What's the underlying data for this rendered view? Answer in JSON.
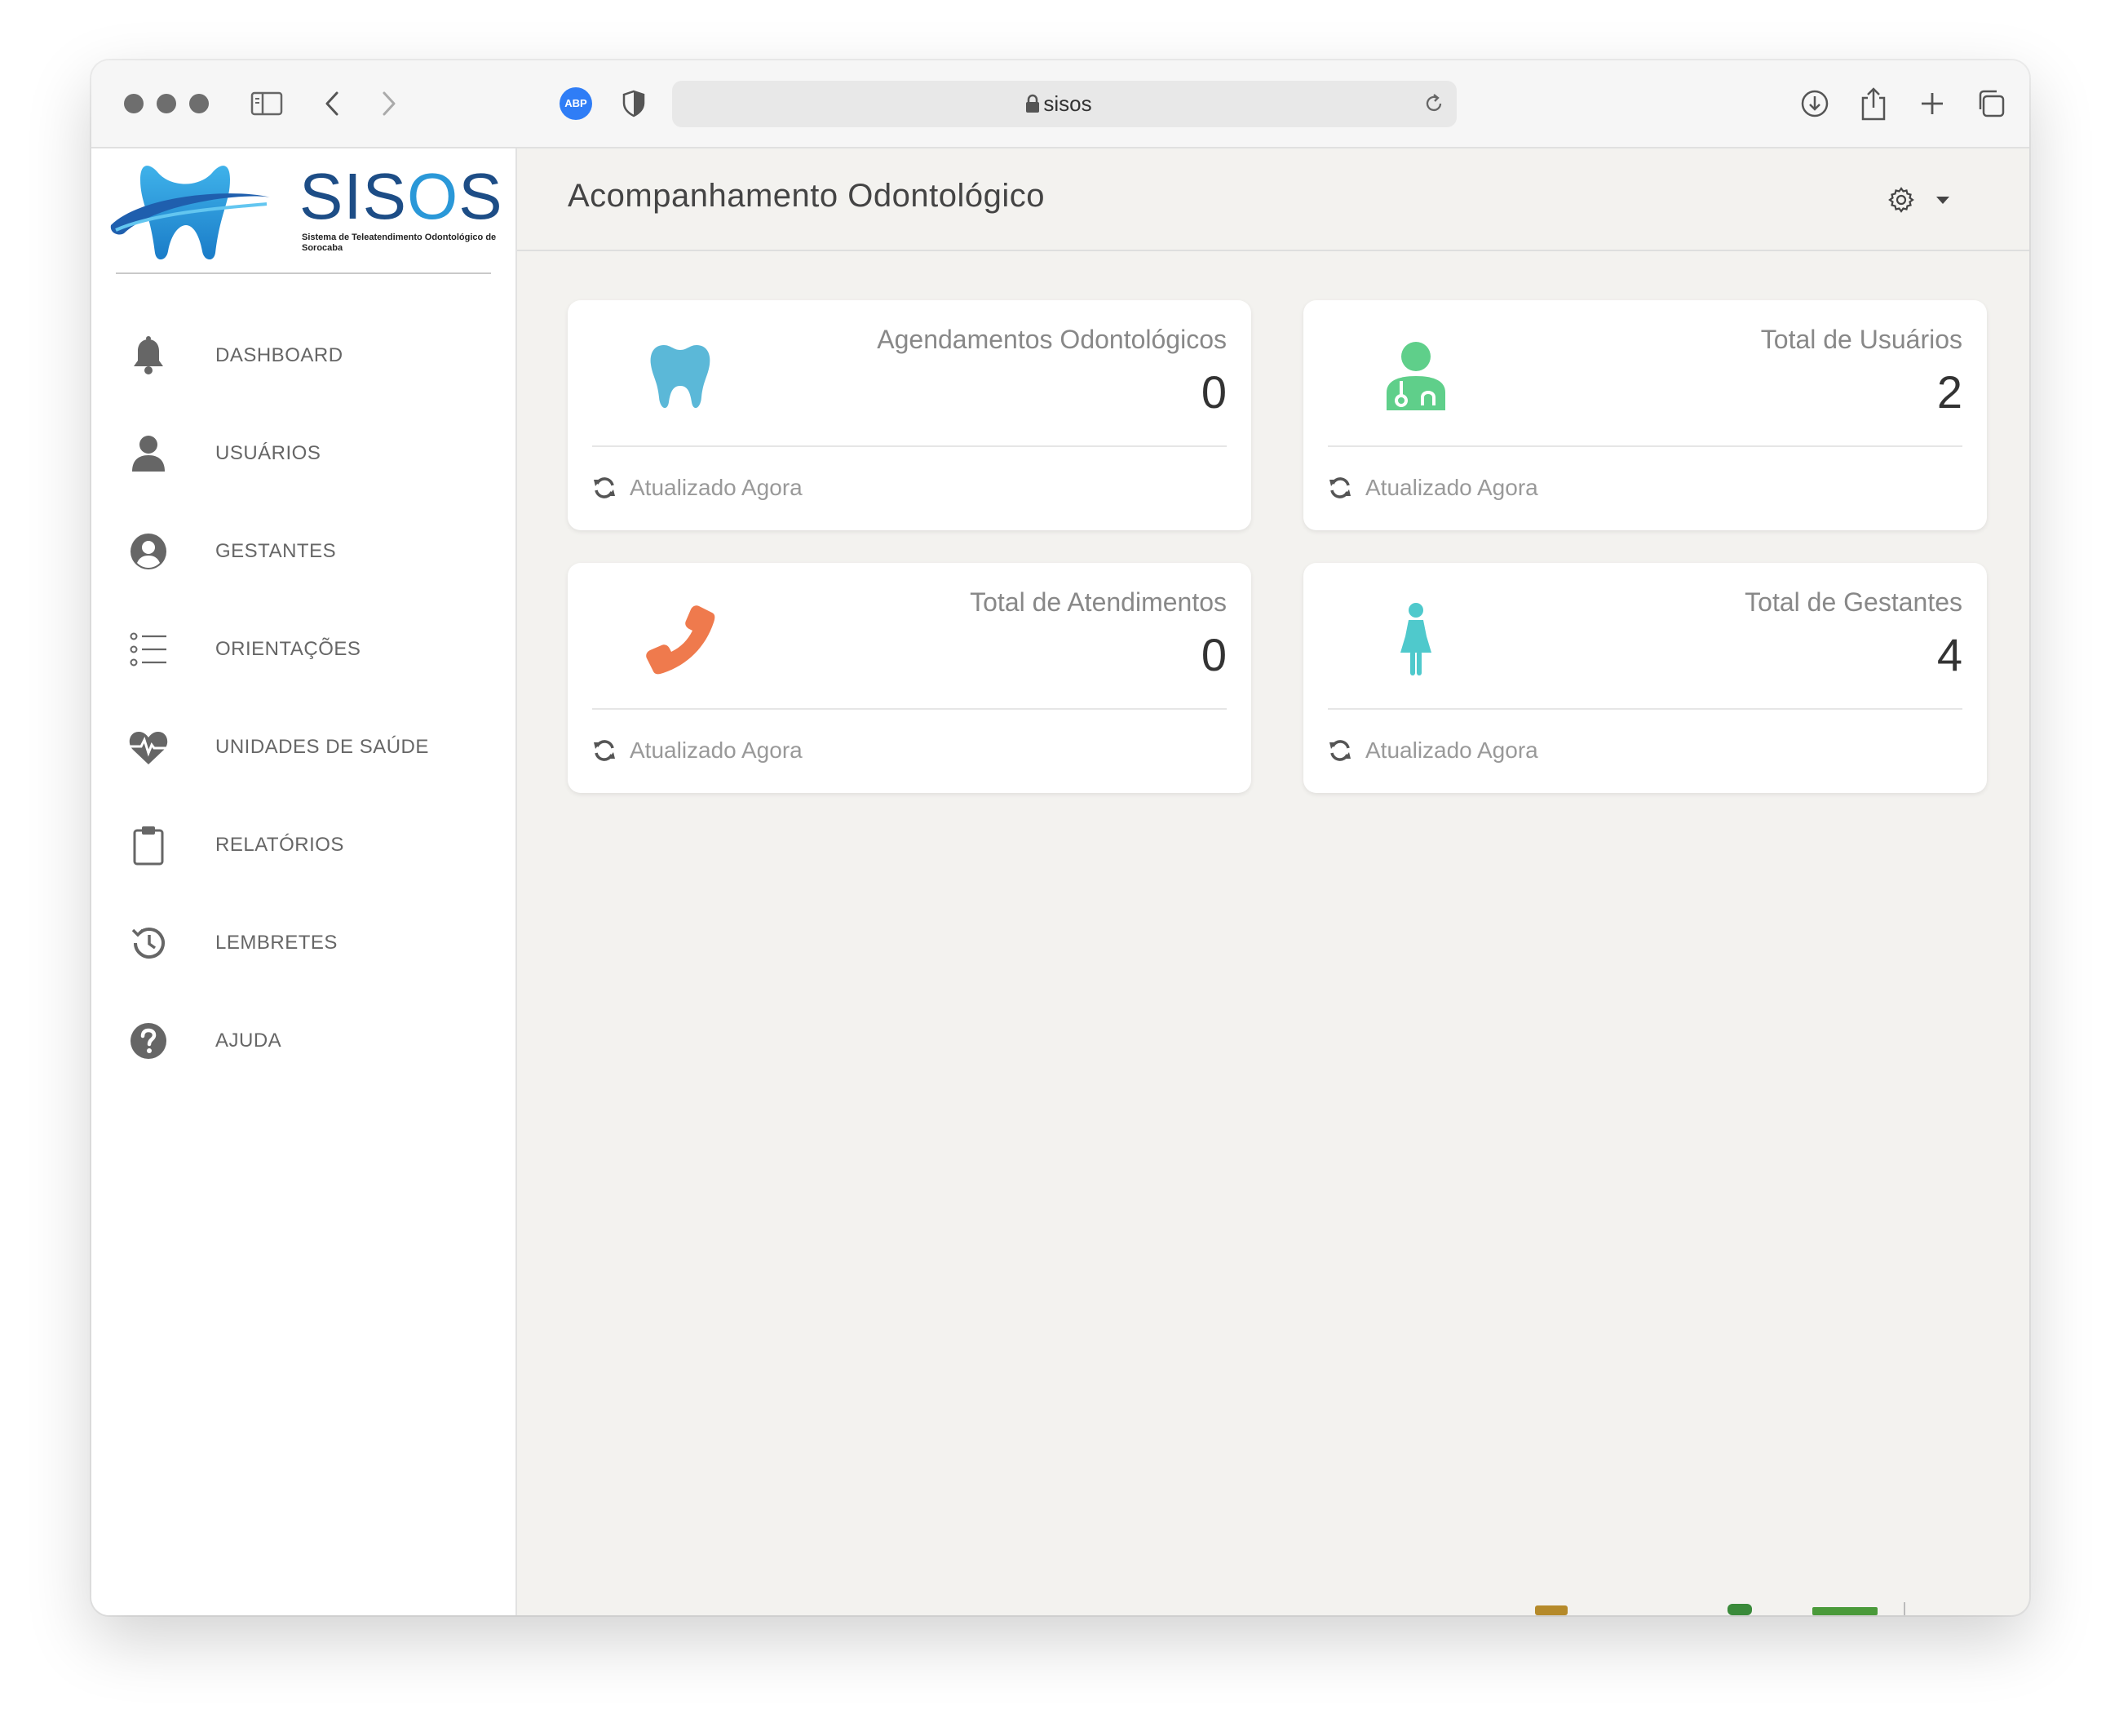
{
  "browser": {
    "url": "sisos",
    "adblock_label": "ABP"
  },
  "logo": {
    "title_part1": "SIS",
    "title_o": "O",
    "title_part2": "S",
    "subtitle": "Sistema de Teleatendimento Odontológico de Sorocaba"
  },
  "sidebar": {
    "items": [
      {
        "label": "DASHBOARD",
        "icon": "bell-icon"
      },
      {
        "label": "USUÁRIOS",
        "icon": "user-icon"
      },
      {
        "label": "GESTANTES",
        "icon": "user-circle-icon"
      },
      {
        "label": "ORIENTAÇÕES",
        "icon": "list-icon"
      },
      {
        "label": "UNIDADES DE SAÚDE",
        "icon": "heartbeat-icon"
      },
      {
        "label": "RELATÓRIOS",
        "icon": "clipboard-icon"
      },
      {
        "label": "LEMBRETES",
        "icon": "history-icon"
      },
      {
        "label": "AJUDA",
        "icon": "question-icon"
      }
    ]
  },
  "header": {
    "title": "Acompanhamento Odontológico"
  },
  "cards": [
    {
      "label": "Agendamentos Odontológicos",
      "value": "0",
      "footer": "Atualizado Agora",
      "icon": "tooth-icon",
      "color": "#5bb8d8"
    },
    {
      "label": "Total de Usuários",
      "value": "2",
      "footer": "Atualizado Agora",
      "icon": "doctor-icon",
      "color": "#5fcf8a"
    },
    {
      "label": "Total de Atendimentos",
      "value": "0",
      "footer": "Atualizado Agora",
      "icon": "phone-icon",
      "color": "#ef7a4d"
    },
    {
      "label": "Total de Gestantes",
      "value": "4",
      "footer": "Atualizado Agora",
      "icon": "female-icon",
      "color": "#4fc9cc"
    }
  ]
}
